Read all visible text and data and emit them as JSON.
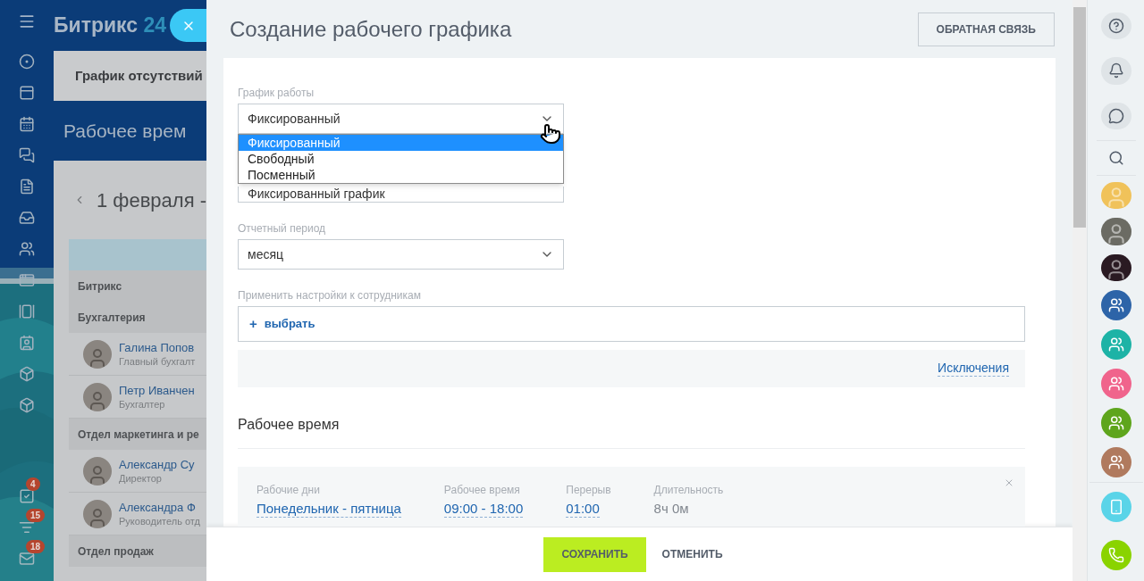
{
  "logo": {
    "text": "Битрикс",
    "number": "24"
  },
  "left_nav": {
    "counters": [
      {
        "badge": "4"
      },
      {
        "badge": "15"
      },
      {
        "badge": "18"
      }
    ]
  },
  "background_page": {
    "tab": "График отсутствий",
    "title": "Рабочее врем",
    "date": "1 февраля -",
    "rows": [
      {
        "kind": "group",
        "label": "Битрикс"
      },
      {
        "kind": "group",
        "label": "Бухгалтерия"
      },
      {
        "kind": "person",
        "name": "Галина Попов",
        "role": "Главный бухгалт"
      },
      {
        "kind": "person",
        "name": "Петр Иванчен",
        "role": "Бухгалтер"
      },
      {
        "kind": "group",
        "label": "Отдел маркетинга и ре"
      },
      {
        "kind": "person",
        "name": "Александр Су",
        "role": "Директор"
      },
      {
        "kind": "person",
        "name": "Александра Ф",
        "role": "Руководитель отд"
      },
      {
        "kind": "group",
        "label": "Отдел продаж"
      }
    ]
  },
  "slider": {
    "title": "Создание рабочего графика",
    "feedback_button": "ОБРАТНАЯ СВЯЗЬ",
    "schedule_type": {
      "label": "График работы",
      "value": "Фиксированный",
      "expanded": true,
      "options": [
        {
          "label": "Фиксированный",
          "selected": true
        },
        {
          "label": "Свободный",
          "selected": false
        },
        {
          "label": "Посменный",
          "selected": false
        }
      ]
    },
    "name_field": {
      "value": "Фиксированный график"
    },
    "period": {
      "label": "Отчетный период",
      "value": "месяц"
    },
    "employees": {
      "label": "Применить настройки к сотрудникам",
      "add_icon": "+",
      "add_link": "выбрать",
      "exceptions_link": "Исключения"
    },
    "work_time": {
      "heading": "Рабочее время",
      "shifts": [
        {
          "columns": [
            {
              "label": "Рабочие дни",
              "value": "Понедельник - пятница",
              "editable": true
            },
            {
              "label": "Рабочее время",
              "value": "09:00 - 18:00",
              "editable": true
            },
            {
              "label": "Перерыв",
              "value": "01:00",
              "editable": true
            },
            {
              "label": "Длительность",
              "value": "8ч 0м",
              "editable": false
            }
          ]
        }
      ]
    },
    "footer": {
      "save": "СОХРАНИТЬ",
      "cancel": "ОТМЕНИТЬ"
    }
  },
  "right_panel": {
    "items": [
      {
        "kind": "help"
      },
      {
        "kind": "notifications"
      },
      {
        "kind": "chat"
      },
      {
        "kind": "search"
      },
      {
        "kind": "avatar",
        "color": "#f0c25a"
      },
      {
        "kind": "avatar",
        "color": "#6b6b63"
      },
      {
        "kind": "avatar",
        "color": "#2a1a22"
      },
      {
        "kind": "group",
        "color": "#2d64a8"
      },
      {
        "kind": "group",
        "color": "#1db3a6"
      },
      {
        "kind": "group",
        "color": "#f0648c"
      },
      {
        "kind": "group",
        "color": "#5ea51c"
      },
      {
        "kind": "group",
        "color": "#b07a5e"
      }
    ],
    "bottom": [
      {
        "kind": "cloud-phone"
      },
      {
        "kind": "call"
      }
    ]
  }
}
